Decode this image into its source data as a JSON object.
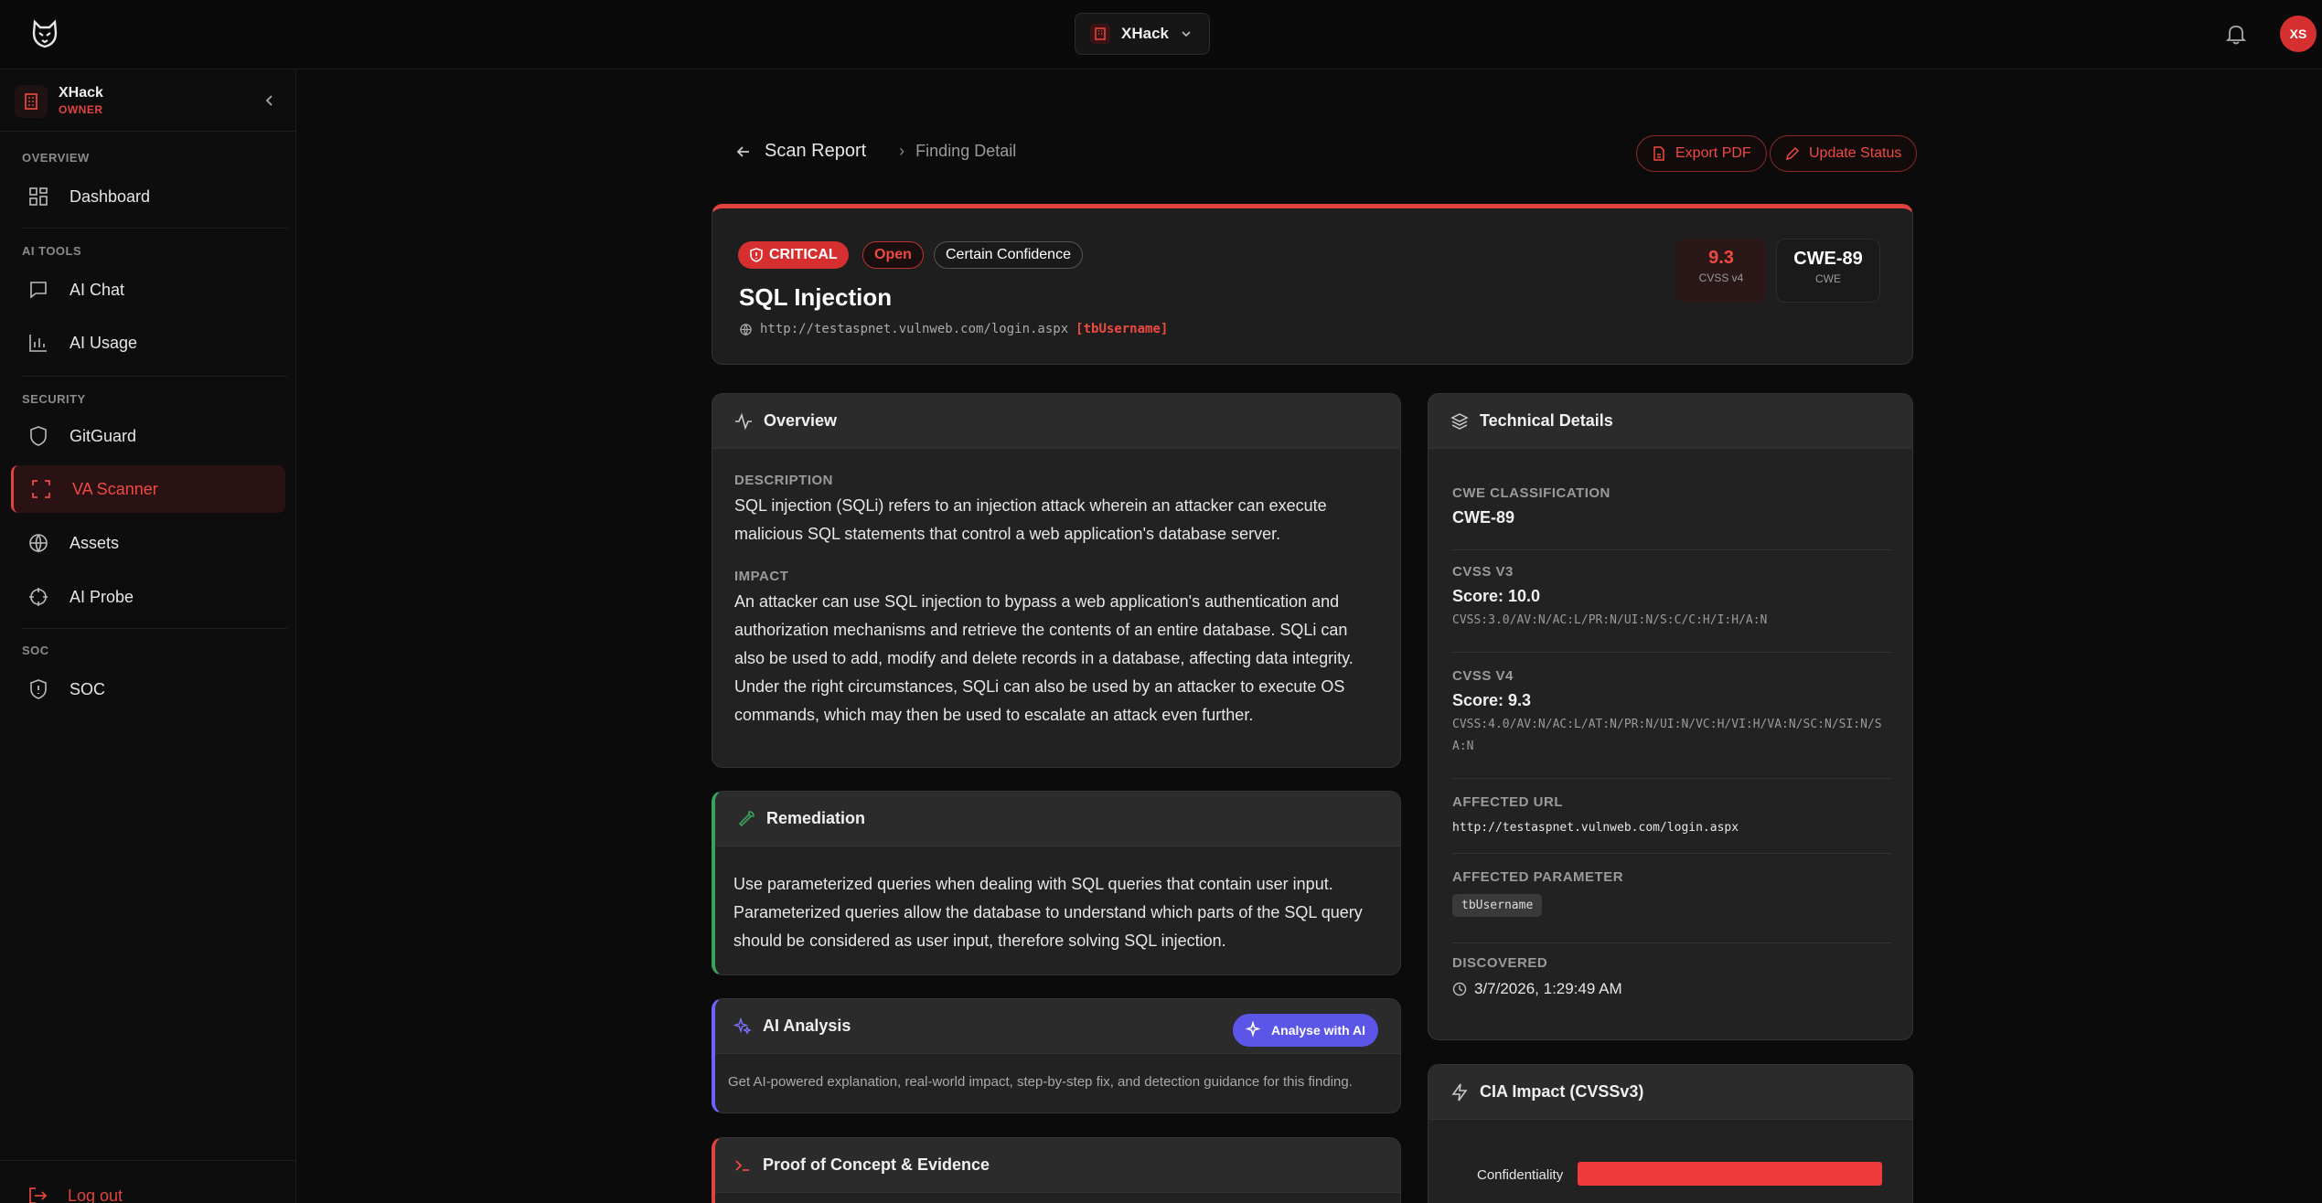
{
  "topbar": {
    "workspace": "XHack",
    "avatar_initials": "XS"
  },
  "sidebar": {
    "org_name": "XHack",
    "org_role": "OWNER",
    "sections": {
      "overview": "OVERVIEW",
      "ai_tools": "AI TOOLS",
      "security": "SECURITY",
      "soc": "SOC"
    },
    "items": {
      "dashboard": "Dashboard",
      "ai_chat": "AI Chat",
      "ai_usage": "AI Usage",
      "gitguard": "GitGuard",
      "va_scanner": "VA Scanner",
      "assets": "Assets",
      "ai_probe": "AI Probe",
      "soc": "SOC"
    },
    "logout": "Log out",
    "active_item": "VA Scanner"
  },
  "breadcrumb": {
    "back": "Scan Report",
    "current": "Finding Detail"
  },
  "actions": {
    "export": "Export PDF",
    "update": "Update Status"
  },
  "finding": {
    "severity": "CRITICAL",
    "status": "Open",
    "confidence": "Certain Confidence",
    "title": "SQL Injection",
    "url": "http://testaspnet.vulnweb.com/login.aspx",
    "param": "[tbUsername]",
    "cvss_score": "9.3",
    "cvss_label": "CVSS v4",
    "cwe": "CWE-89",
    "cwe_label": "CWE"
  },
  "overview": {
    "title": "Overview",
    "description_label": "DESCRIPTION",
    "description": "SQL injection (SQLi) refers to an injection attack wherein an attacker can execute malicious SQL statements that control a web application's database server.",
    "impact_label": "IMPACT",
    "impact": "An attacker can use SQL injection to bypass a web application's authentication and authorization mechanisms and retrieve the contents of an entire database. SQLi can also be used to add, modify and delete records in a database, affecting data integrity. Under the right circumstances, SQLi can also be used by an attacker to execute OS commands, which may then be used to escalate an attack even further."
  },
  "remediation": {
    "title": "Remediation",
    "text": "Use parameterized queries when dealing with SQL queries that contain user input. Parameterized queries allow the database to understand which parts of the SQL query should be considered as user input, therefore solving SQL injection."
  },
  "ai_analysis": {
    "title": "AI Analysis",
    "button": "Analyse with AI",
    "text": "Get AI-powered explanation, real-world impact, step-by-step fix, and detection guidance for this finding."
  },
  "poc": {
    "title": "Proof of Concept & Evidence"
  },
  "technical": {
    "title": "Technical Details",
    "cwe_label": "CWE CLASSIFICATION",
    "cwe_value": "CWE-89",
    "cvss3_label": "CVSS V3",
    "cvss3_score": "Score: 10.0",
    "cvss3_vector": "CVSS:3.0/AV:N/AC:L/PR:N/UI:N/S:C/C:H/I:H/A:N",
    "cvss4_label": "CVSS V4",
    "cvss4_score": "Score: 9.3",
    "cvss4_vector": "CVSS:4.0/AV:N/AC:L/AT:N/PR:N/UI:N/VC:H/VI:H/VA:N/SC:N/SI:N/SA:N",
    "url_label": "AFFECTED URL",
    "url_value": "http://testaspnet.vulnweb.com/login.aspx",
    "param_label": "AFFECTED PARAMETER",
    "param_value": "tbUsername",
    "discovered_label": "DISCOVERED",
    "discovered_value": "3/7/2026, 1:29:49 AM"
  },
  "cia": {
    "title": "CIA Impact (CVSSv3)",
    "rows": [
      {
        "label": "Confidentiality",
        "level": 1.0
      }
    ]
  },
  "colors": {
    "accent": "#e0443c",
    "remediation": "#3aa35a",
    "ai": "#5b56e8"
  }
}
